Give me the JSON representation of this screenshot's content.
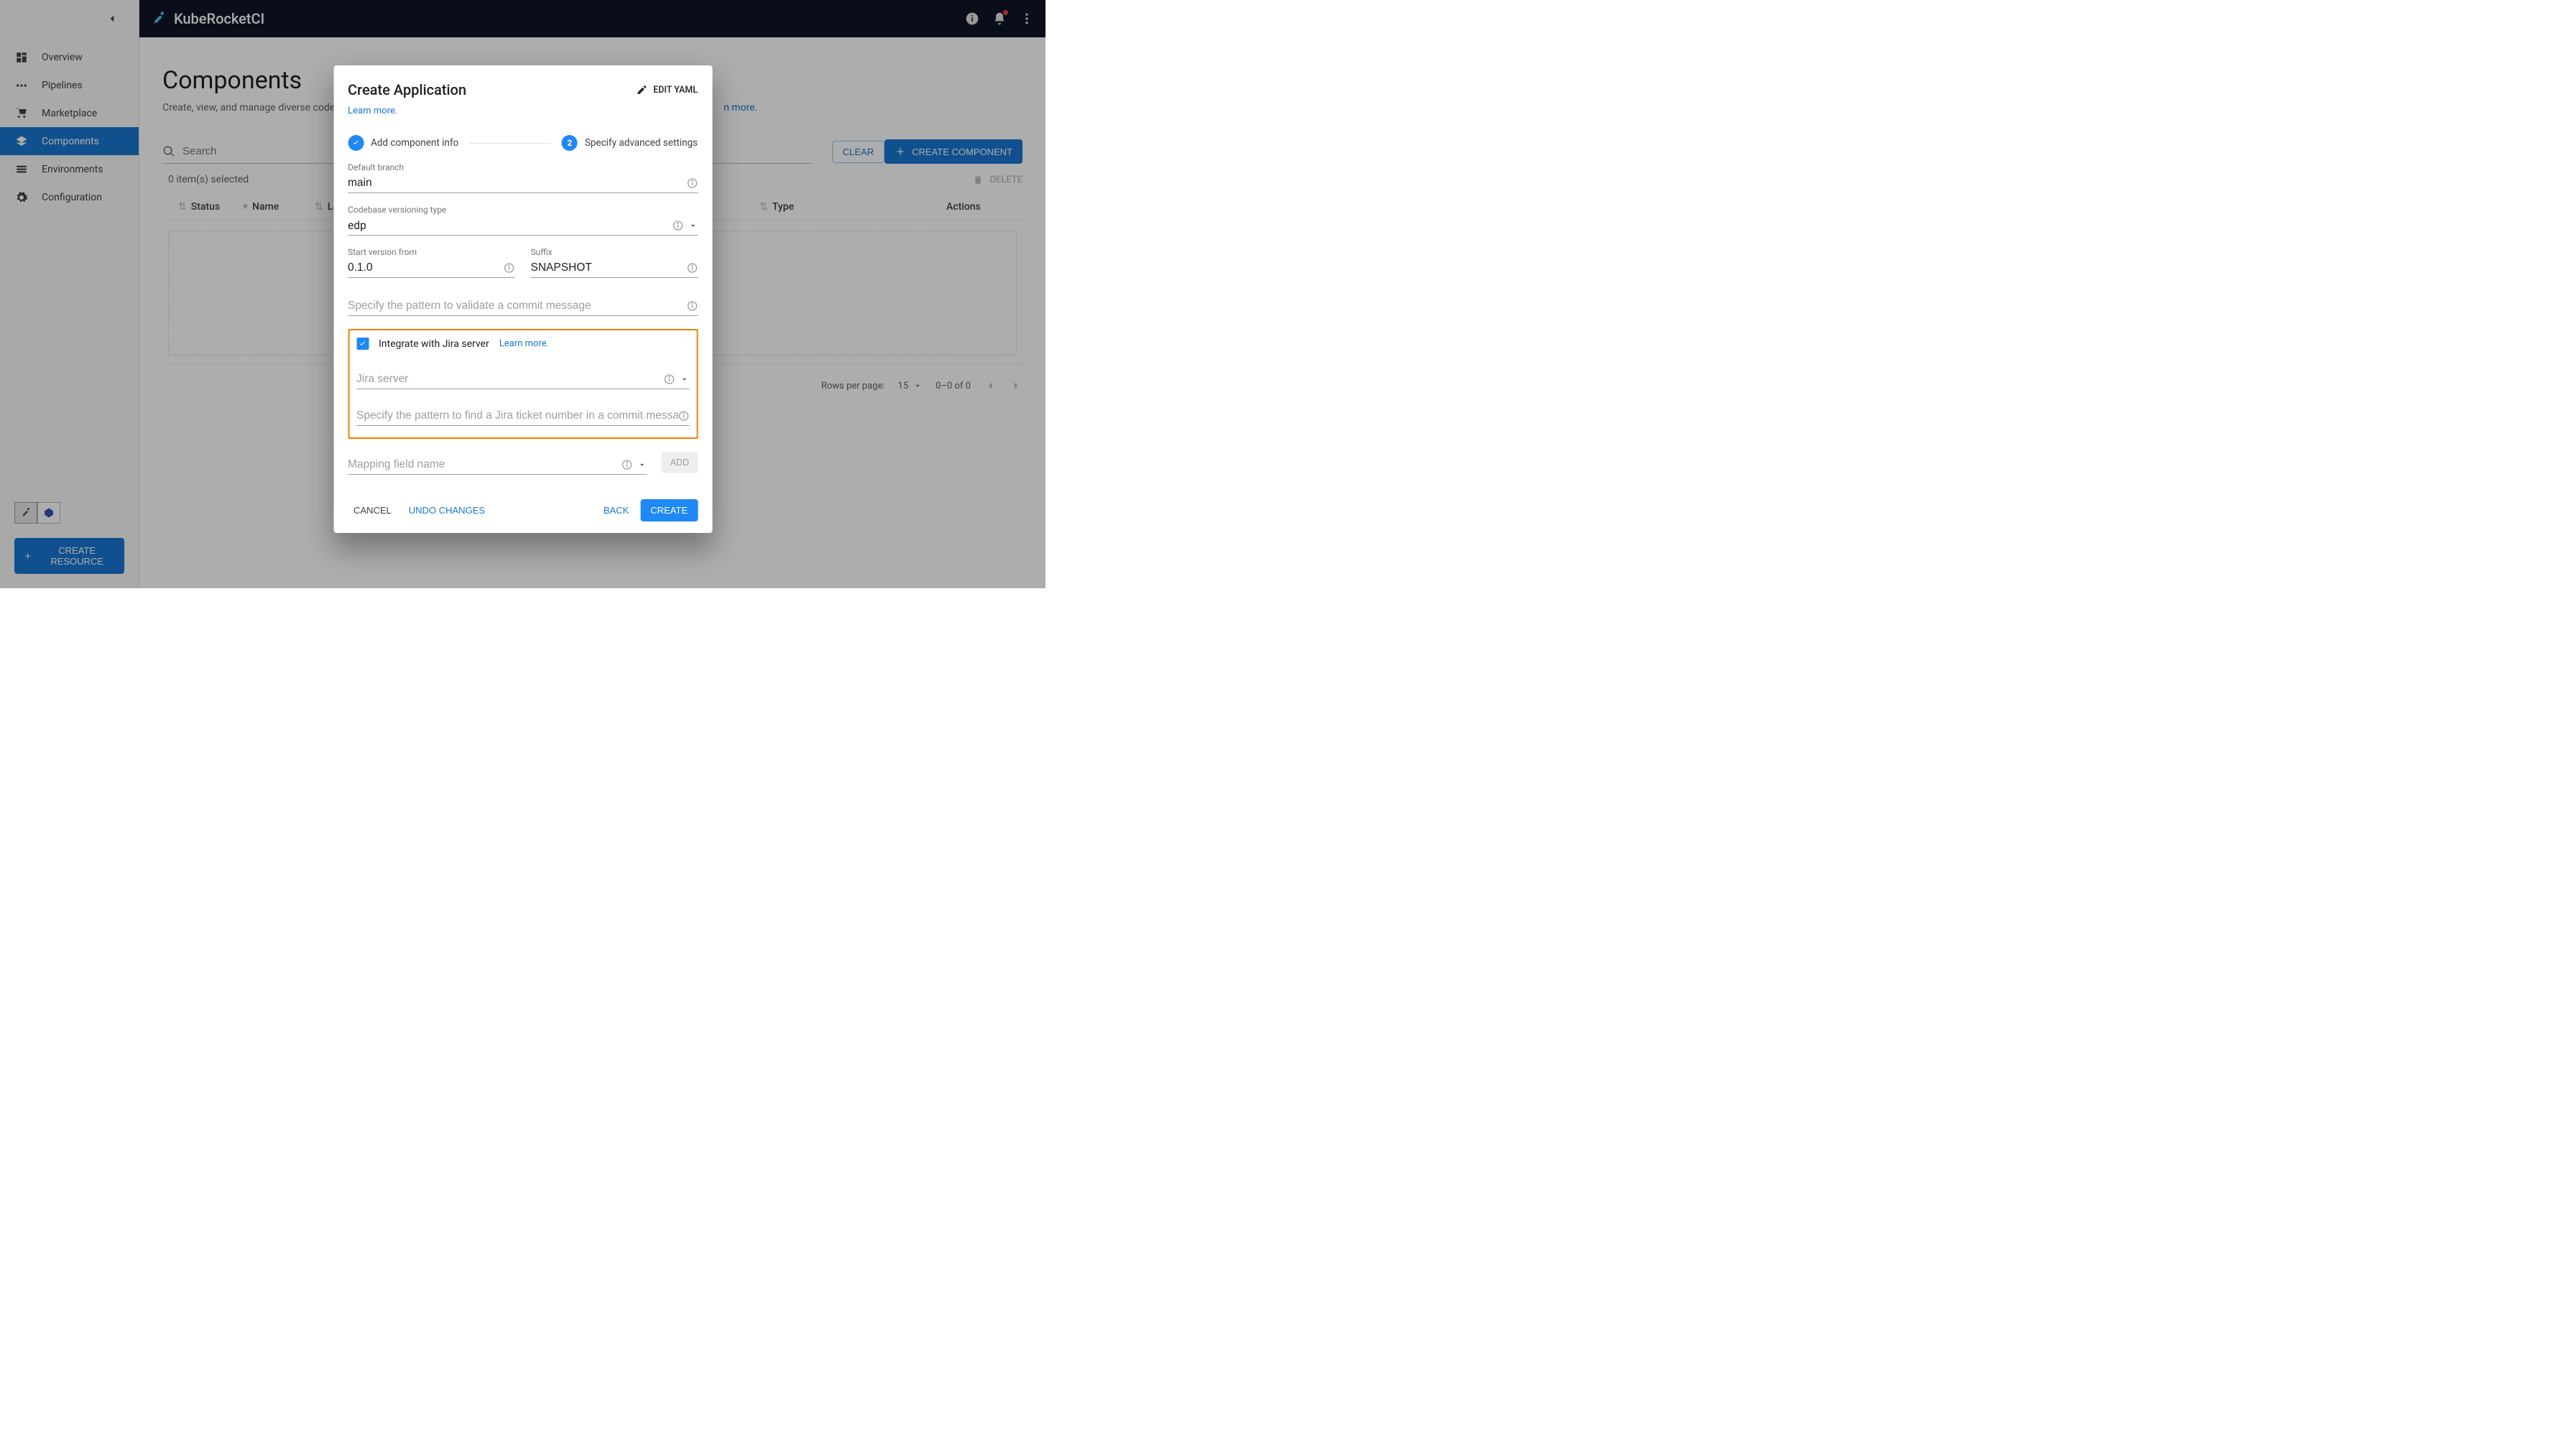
{
  "brand": "KubeRocketCI",
  "sidebar": {
    "items": [
      {
        "label": "Overview"
      },
      {
        "label": "Pipelines"
      },
      {
        "label": "Marketplace"
      },
      {
        "label": "Components"
      },
      {
        "label": "Environments"
      },
      {
        "label": "Configuration"
      }
    ],
    "create_resource": "CREATE RESOURCE"
  },
  "page": {
    "title": "Components",
    "subtitle_prefix": "Create, view, and manage diverse codeba",
    "subtitle_suffix_link": "n more."
  },
  "toolbar": {
    "search_placeholder": "Search",
    "clear": "CLEAR",
    "create_component": "CREATE COMPONENT"
  },
  "table": {
    "selected_text": "0 item(s) selected",
    "delete": "DELETE",
    "headers": {
      "status": "Status",
      "name": "Name",
      "lang": "Lan",
      "type": "Type",
      "actions": "Actions"
    }
  },
  "pager": {
    "rows_label": "Rows per page:",
    "rows_value": "15",
    "range": "0–0 of 0"
  },
  "dialog": {
    "title": "Create Application",
    "edit_yaml": "EDIT YAML",
    "learn": "Learn more.",
    "step1": "Add component info",
    "step2": "Specify advanced settings",
    "step2_num": "2",
    "fields": {
      "default_branch": {
        "label": "Default branch",
        "value": "main"
      },
      "versioning": {
        "label": "Codebase versioning type",
        "value": "edp"
      },
      "start_version": {
        "label": "Start version from",
        "value": "0.1.0"
      },
      "suffix": {
        "label": "Suffix",
        "value": "SNAPSHOT"
      },
      "commit_pattern_placeholder": "Specify the pattern to validate a commit message",
      "jira_checkbox": "Integrate with Jira server",
      "jira_learn": "Learn more.",
      "jira_server_placeholder": "Jira server",
      "jira_pattern_placeholder": "Specify the pattern to find a Jira ticket number in a commit message",
      "mapping_placeholder": "Mapping field name",
      "add": "ADD"
    },
    "actions": {
      "cancel": "CANCEL",
      "undo": "UNDO CHANGES",
      "back": "BACK",
      "create": "CREATE"
    }
  }
}
